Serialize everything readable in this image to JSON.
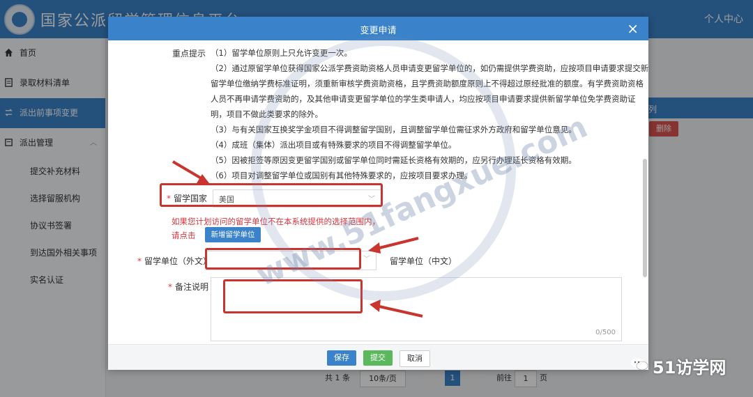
{
  "header": {
    "site_title": "国家公派留学管理信息平台",
    "user_center": "个人中心"
  },
  "sidebar": {
    "items": [
      {
        "label": "首页"
      },
      {
        "label": "录取材料清单"
      },
      {
        "label": "派出前事项变更"
      },
      {
        "label": "派出管理"
      }
    ],
    "sub_items": [
      {
        "label": "提交补充材料"
      },
      {
        "label": "选择留服机构"
      },
      {
        "label": "协议书签署"
      },
      {
        "label": "到达国外相关事项"
      },
      {
        "label": "实名认证"
      }
    ]
  },
  "background": {
    "panel_header": "列",
    "delete_button": "删除",
    "pager": {
      "total": "共 1 条",
      "page_size": "10条/页",
      "current_page": "1",
      "goto": "前往",
      "goto_value": "1",
      "page_unit": "页"
    }
  },
  "modal": {
    "title": "变更申请",
    "close": "×",
    "key_tips_label": "重点提示",
    "tips": [
      "（1）留学单位原则上只允许变更一次。",
      "（2）通过原留学单位获得国家公派学费资助资格人员申请变更留学单位的，如仍需提供学费资助，应按项目申请要求提交新",
      "留学单位缴纳学费标准证明，须重新审核学费资助资格，且学费资助额度原则上不得超过原经批准的额度。有学费资助资格",
      "人员不再申请学费资助的，及其他申请变更留学单位的学生类申请人，均应按项目申请要求提供新留学单位免学费资助证",
      "明，项目不做此类要求的除外。",
      "（3）与有关国家互换奖学金项目不得调整留学国别，且调整留学单位需征求外方政府和留学单位意见。",
      "（4）成班（集体）派出项目或有特殊要求的项目不得调整留学单位。",
      "（5）因被拒签等原因变更留学国别或留学单位同时需延长资格有效期的，应另行办理延长资格有效期。",
      "（6）项目对调整留学单位或国别有其他特殊要求的，应按项目要求办理。"
    ],
    "country": {
      "label": "留学国家",
      "required": "*",
      "value": "美国"
    },
    "warning_line1": "如果您计划访问的留学单位不在本系统提供的选择范围内，",
    "warning_line2": "请点击",
    "add_unit_button": "新增留学单位",
    "unit_foreign": {
      "label": "留学单位（外文）",
      "required": "*"
    },
    "unit_chinese": {
      "label": "留学单位（中文）"
    },
    "remarks": {
      "label": "备注说明",
      "required": "*",
      "counter": "0/500"
    },
    "buttons": {
      "save": "保存",
      "submit": "提交",
      "cancel": "取消"
    }
  },
  "watermark": {
    "text": "www.51fangxue.com"
  },
  "brand": {
    "text": "51访学网"
  },
  "colors": {
    "primary": "#3a82c9",
    "danger": "#d9534f",
    "success": "#5cb85c",
    "annotation": "#c9342e"
  }
}
